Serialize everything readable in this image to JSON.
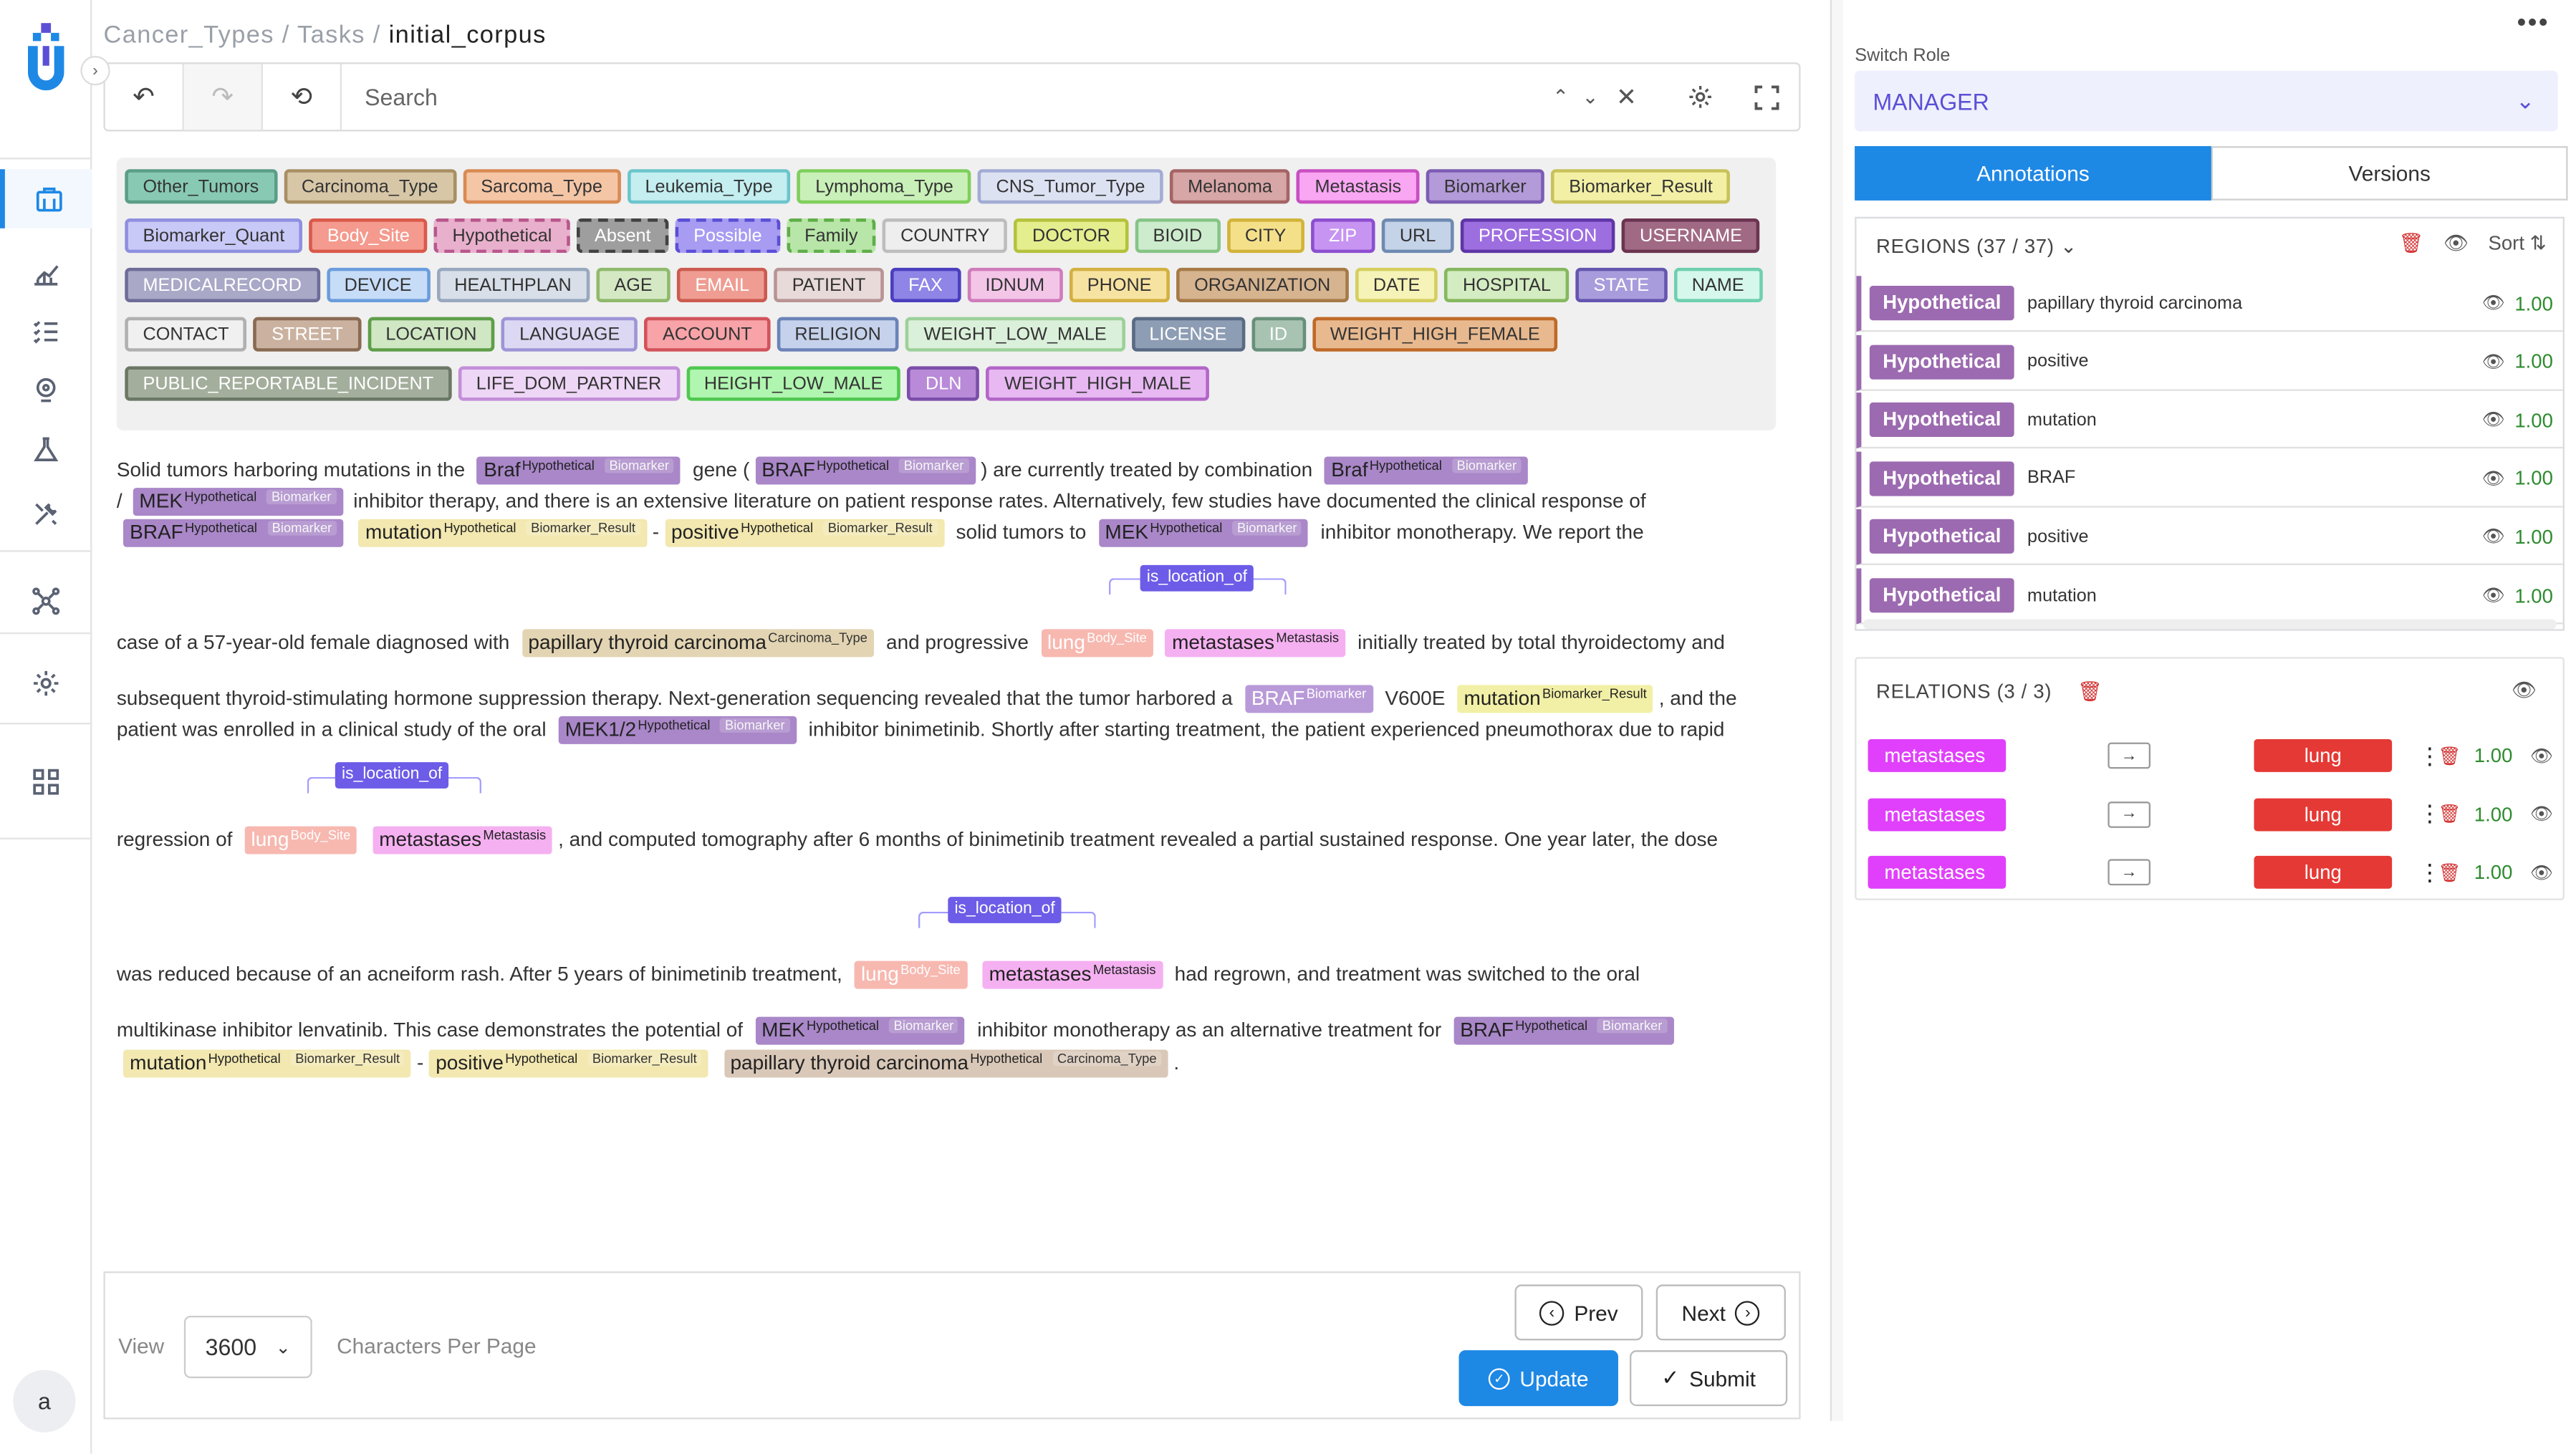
{
  "app": {
    "user_initial": "a"
  },
  "breadcrumb": {
    "part1": "Cancer_Types",
    "sep": " / ",
    "part2": "Tasks",
    "sep2": " / ",
    "current": "initial_corpus"
  },
  "toolbar": {
    "search_placeholder": "Search"
  },
  "labels": [
    {
      "t": "Other_Tumors",
      "bg": "#88c9b4",
      "bd": "#5b9e88"
    },
    {
      "t": "Carcinoma_Type",
      "bg": "#d7c7a7",
      "bd": "#a88f64"
    },
    {
      "t": "Sarcoma_Type",
      "bg": "#f4c6a6",
      "bd": "#d98a54"
    },
    {
      "t": "Leukemia_Type",
      "bg": "#c4eef0",
      "bd": "#6cc6cc"
    },
    {
      "t": "Lymphoma_Type",
      "bg": "#c9f0b8",
      "bd": "#7fcf5c"
    },
    {
      "t": "CNS_Tumor_Type",
      "bg": "#dde2f3",
      "bd": "#a3acd4"
    },
    {
      "t": "Melanoma",
      "bg": "#d7a6a6",
      "bd": "#a66464"
    },
    {
      "t": "Metastasis",
      "bg": "#f9a6f3",
      "bd": "#c84fc2"
    },
    {
      "t": "Biomarker",
      "bg": "#b39ad8",
      "bd": "#7c5cb3"
    },
    {
      "t": "Biomarker_Result",
      "bg": "#f3f0a6",
      "bd": "#c9c25a"
    },
    {
      "t": "Biomarker_Quant",
      "bg": "#c9c9f7",
      "bd": "#8f8fe0"
    },
    {
      "t": "Body_Site",
      "bg": "#f49a8e",
      "bd": "#d9594a",
      "fc": "#fff"
    },
    {
      "t": "Hypothetical",
      "bg": "#e8b0cc",
      "bd": "#b8578c",
      "dash": true
    },
    {
      "t": "Absent",
      "bg": "#9e9e9e",
      "bd": "#424242",
      "fc": "#fff",
      "dash": true
    },
    {
      "t": "Possible",
      "bg": "#a79cf2",
      "bd": "#5b4fd6",
      "fc": "#fff",
      "dash": true
    },
    {
      "t": "Family",
      "bg": "#b8e6a8",
      "bd": "#5fae49",
      "dash": true
    },
    {
      "t": "COUNTRY",
      "bg": "#eeeeee",
      "bd": "#bdbdbd"
    },
    {
      "t": "DOCTOR",
      "bg": "#e4ee8e",
      "bd": "#b5c23c"
    },
    {
      "t": "BIOID",
      "bg": "#cdeccd",
      "bd": "#86c486"
    },
    {
      "t": "CITY",
      "bg": "#f5e08a",
      "bd": "#d1b43a"
    },
    {
      "t": "ZIP",
      "bg": "#c794f2",
      "bd": "#8b4fd0",
      "fc": "#fff"
    },
    {
      "t": "URL",
      "bg": "#c4d3e8",
      "bd": "#6f8ab0"
    },
    {
      "t": "PROFESSION",
      "bg": "#9d6ee0",
      "bd": "#5e36a6",
      "fc": "#fff"
    },
    {
      "t": "USERNAME",
      "bg": "#a16a84",
      "bd": "#6b3450",
      "fc": "#fff"
    },
    {
      "t": "MEDICALRECORD",
      "bg": "#a9a8c7",
      "bd": "#6e6d99",
      "fc": "#fff"
    },
    {
      "t": "DEVICE",
      "bg": "#c7dcf7",
      "bd": "#6b9ddc"
    },
    {
      "t": "HEALTHPLAN",
      "bg": "#d8dfe9",
      "bd": "#98a8bf"
    },
    {
      "t": "AGE",
      "bg": "#d5e8c4",
      "bd": "#8fba6c"
    },
    {
      "t": "EMAIL",
      "bg": "#ef9d92",
      "bd": "#cc5b4f",
      "fc": "#fff"
    },
    {
      "t": "PATIENT",
      "bg": "#e9dada",
      "bd": "#b89494"
    },
    {
      "t": "FAX",
      "bg": "#8f85e6",
      "bd": "#4b3fc0",
      "fc": "#fff"
    },
    {
      "t": "IDNUM",
      "bg": "#f3c6e8",
      "bd": "#d07cbb"
    },
    {
      "t": "PHONE",
      "bg": "#f7e3a1",
      "bd": "#d3b041"
    },
    {
      "t": "ORGANIZATION",
      "bg": "#d6b48f",
      "bd": "#a67a48"
    },
    {
      "t": "DATE",
      "bg": "#f6f3b8",
      "bd": "#d5ce5e"
    },
    {
      "t": "HOSPITAL",
      "bg": "#d4ecc1",
      "bd": "#86b85f"
    },
    {
      "t": "STATE",
      "bg": "#a89cdc",
      "bd": "#6455b0",
      "fc": "#fff"
    },
    {
      "t": "NAME",
      "bg": "#d6f7ec",
      "bd": "#6fd0b0"
    },
    {
      "t": "CONTACT",
      "bg": "#f0f0f0",
      "bd": "#b0b0b0"
    },
    {
      "t": "STREET",
      "bg": "#cbb2a0",
      "bd": "#8a6a52",
      "fc": "#fff"
    },
    {
      "t": "LOCATION",
      "bg": "#cfe7c3",
      "bd": "#5e9e48"
    },
    {
      "t": "LANGUAGE",
      "bg": "#dcd8f3",
      "bd": "#9d95d6"
    },
    {
      "t": "ACCOUNT",
      "bg": "#f7a3a8",
      "bd": "#d2535b"
    },
    {
      "t": "RELIGION",
      "bg": "#c6d2ec",
      "bd": "#6b83b8"
    },
    {
      "t": "WEIGHT_LOW_MALE",
      "bg": "#dbf0da",
      "bd": "#9cd19a"
    },
    {
      "t": "LICENSE",
      "bg": "#8d9db4",
      "bd": "#596a84",
      "fc": "#fff"
    },
    {
      "t": "ID",
      "bg": "#a9c3b3",
      "bd": "#67907a",
      "fc": "#fff"
    },
    {
      "t": "WEIGHT_HIGH_FEMALE",
      "bg": "#e8b98f",
      "bd": "#c06a28"
    },
    {
      "t": "PUBLIC_REPORTABLE_INCIDENT",
      "bg": "#a3ae9c",
      "bd": "#6c7866",
      "fc": "#fff"
    },
    {
      "t": "LIFE_DOM_PARTNER",
      "bg": "#eed6f6",
      "bd": "#c48fd9"
    },
    {
      "t": "HEIGHT_LOW_MALE",
      "bg": "#b0f5b0",
      "bd": "#4fc94f"
    },
    {
      "t": "DLN",
      "bg": "#b88ad8",
      "bd": "#7c4eaa",
      "fc": "#fff"
    },
    {
      "t": "WEIGHT_HIGH_MALE",
      "bg": "#e7b8f2",
      "bd": "#b366c9"
    }
  ],
  "doc": {
    "l1a": "Solid tumors harboring mutations in the",
    "l1b": "gene (",
    "l1c": ") are currently treated by combination",
    "l2a": "/",
    "l2b": "inhibitor therapy, and there is an extensive literature on patient response rates. Alternatively, few studies have documented the clinical response of",
    "l3a": "-",
    "l3b": "solid tumors to",
    "l3c": "inhibitor monotherapy. We report the",
    "l4a": "case of a 57-year-old female diagnosed with",
    "l4b": "and progressive",
    "l4c": "initially treated by total thyroidectomy and",
    "l5a": "subsequent thyroid-stimulating hormone suppression therapy. Next-generation sequencing revealed that the tumor harbored a",
    "l5b": "V600E",
    "l5c": ", and the",
    "l6a": "patient was enrolled in a clinical study of the oral",
    "l6b": "inhibitor binimetinib. Shortly after starting treatment, the patient experienced pneumothorax due to rapid",
    "l7a": "regression of",
    "l7b": ", and computed tomography after 6 months of binimetinib treatment revealed a partial sustained response. One year later, the dose",
    "l8a": "was reduced because of an acneiform rash. After 5 years of binimetinib treatment,",
    "l8b": "had regrown, and treatment was switched to the oral",
    "l9a": "multikinase inhibitor lenvatinib. This case demonstrates the potential of",
    "l9b": "inhibitor monotherapy as an alternative treatment for",
    "l10a": "-",
    "l10b": ".",
    "rel_label": "is_location_of",
    "spans": {
      "braf1": "Braf",
      "braf2": "BRAF",
      "braf3": "Braf",
      "mek1": "MEK",
      "braf4": "BRAF",
      "mutation": "mutation",
      "positive": "positive",
      "mek2": "MEK",
      "ptc": "papillary thyroid carcinoma",
      "lung": "lung",
      "metastases": "metastases",
      "braf5": "BRAF",
      "mutation2": "mutation",
      "mek12": "MEK1/2",
      "mek3": "MEK",
      "braf6": "BRAF",
      "ptc2": "papillary thyroid carcinoma"
    },
    "tags": {
      "hyp": "Hypothetical",
      "bio": "Biomarker",
      "bres": "Biomarker_Result",
      "carc": "Carcinoma_Type",
      "body": "Body_Site",
      "meta": "Metastasis"
    }
  },
  "pager": {
    "view_label": "View",
    "view_value": "3600",
    "cpp_label": "Characters Per Page",
    "prev": "Prev",
    "next": "Next",
    "update": "Update",
    "submit": "Submit"
  },
  "right": {
    "switch_role_label": "Switch Role",
    "role": "MANAGER",
    "tab_annotations": "Annotations",
    "tab_versions": "Versions",
    "regions_title": "REGIONS (37 / 37)",
    "sort_label": "Sort",
    "regions": [
      {
        "label": "Hypothetical",
        "text": "papillary thyroid carcinoma",
        "score": "1.00"
      },
      {
        "label": "Hypothetical",
        "text": "positive",
        "score": "1.00"
      },
      {
        "label": "Hypothetical",
        "text": "mutation",
        "score": "1.00"
      },
      {
        "label": "Hypothetical",
        "text": "BRAF",
        "score": "1.00"
      },
      {
        "label": "Hypothetical",
        "text": "positive",
        "score": "1.00"
      },
      {
        "label": "Hypothetical",
        "text": "mutation",
        "score": "1.00"
      }
    ],
    "relations_title": "RELATIONS (3 / 3)",
    "relations": [
      {
        "from": "metastases",
        "to": "lung",
        "score": "1.00"
      },
      {
        "from": "metastases",
        "to": "lung",
        "score": "1.00"
      },
      {
        "from": "metastases",
        "to": "lung",
        "score": "1.00"
      }
    ]
  },
  "colors": {
    "accent": "#1e88e5",
    "hypothetical": "#9c6ab0",
    "metastasis": "#e040fb",
    "body_site": "#e53935",
    "score_green": "#2e8b2e"
  }
}
